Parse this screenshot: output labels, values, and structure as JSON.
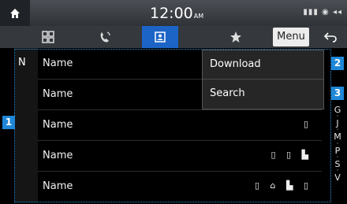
{
  "status_bar": {
    "time": "12:00",
    "ampm": "AM",
    "status_icons": "▮▮▮ ◉ ◂◂",
    "home_icon": "home-icon"
  },
  "tabs": [
    {
      "icon": "dialpad-icon",
      "active": false
    },
    {
      "icon": "call-history-icon",
      "active": false
    },
    {
      "icon": "contacts-icon",
      "active": true
    },
    {
      "icon": "favorites-star-icon",
      "active": false
    }
  ],
  "menu_label": "Menu",
  "index_letter": "N",
  "contacts": [
    {
      "name": "Name",
      "icons": ""
    },
    {
      "name": "Name",
      "icons": ""
    },
    {
      "name": "Name",
      "icons": "▯"
    },
    {
      "name": "Name",
      "icons": "▯ ▯ ▙"
    },
    {
      "name": "Name",
      "icons": "▯ ⌂ ▙ ▯"
    }
  ],
  "alphabet_index": [
    "G",
    "J",
    "M",
    "P",
    "S",
    "V"
  ],
  "dropdown": {
    "items": [
      "Download",
      "Search"
    ]
  },
  "callouts": [
    "1",
    "2",
    "3"
  ]
}
